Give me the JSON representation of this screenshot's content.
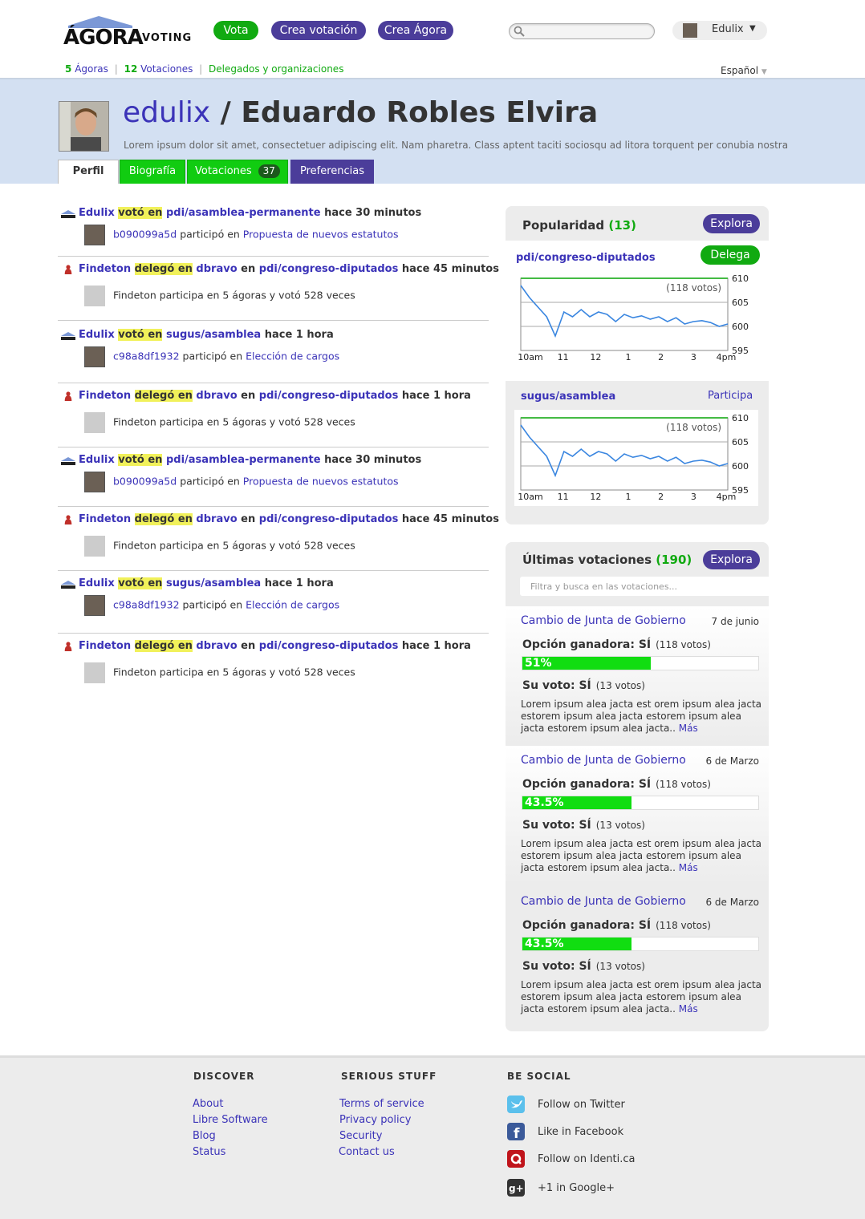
{
  "header": {
    "logo_text": "ÁGORA",
    "logo_sub": "VOTING",
    "buttons": {
      "vota": "Vota",
      "crea_votacion": "Crea votación",
      "crea_agora": "Crea Ágora"
    },
    "search_placeholder": "",
    "user": "Edulix"
  },
  "subnav": {
    "agoras_count": "5",
    "agoras_label": "Ágoras",
    "votaciones_count": "12",
    "votaciones_label": "Votaciones",
    "delegados": "Delegados y organizaciones",
    "sep": "|",
    "language": "Español"
  },
  "profile": {
    "username": "edulix",
    "slash": " / ",
    "fullname": "Eduardo Robles Elvira",
    "description": "Lorem ipsum dolor sit amet, consectetuer adipiscing elit. Nam pharetra. Class aptent taciti sociosqu ad litora torquent per conubia nostra",
    "tabs": {
      "perfil": "Perfil",
      "biografia": "Biografía",
      "votaciones": "Votaciones",
      "votaciones_count": "37",
      "preferencias": "Preferencias"
    }
  },
  "feed": [
    {
      "type": "vote",
      "actor": "Edulix",
      "verb": "votó en",
      "target": "pdi/asamblea-permanente",
      "time": "hace 30 minutos",
      "sub_id": "b090099a5d",
      "sub_text": "participó en",
      "sub_link": "Propuesta de nuevos estatutos"
    },
    {
      "type": "delegate",
      "actor": "Findeton",
      "verb": "delegó en",
      "delegate": "dbravo",
      "en": "en",
      "target": "pdi/congreso-diputados",
      "time": "hace 45 minutos",
      "sub_text": "Findeton participa en 5 ágoras y votó 528 veces"
    },
    {
      "type": "vote",
      "actor": "Edulix",
      "verb": "votó en",
      "target": "sugus/asamblea",
      "time": "hace 1 hora",
      "sub_id": "c98a8df1932",
      "sub_text": "participó en",
      "sub_link": "Elección de cargos"
    },
    {
      "type": "delegate",
      "actor": "Findeton",
      "verb": "delegó en",
      "delegate": "dbravo",
      "en": "en",
      "target": "pdi/congreso-diputados",
      "time": "hace 1 hora",
      "sub_text": "Findeton participa en 5 ágoras y votó 528 veces"
    },
    {
      "type": "vote",
      "actor": "Edulix",
      "verb": "votó en",
      "target": "pdi/asamblea-permanente",
      "time": "hace 30 minutos",
      "sub_id": "b090099a5d",
      "sub_text": "participó en",
      "sub_link": "Propuesta de nuevos estatutos"
    },
    {
      "type": "delegate",
      "actor": "Findeton",
      "verb": "delegó en",
      "delegate": "dbravo",
      "en": "en",
      "target": "pdi/congreso-diputados",
      "time": "hace 45 minutos",
      "sub_text": "Findeton participa en 5 ágoras y votó 528 veces"
    },
    {
      "type": "vote",
      "actor": "Edulix",
      "verb": "votó en",
      "target": "sugus/asamblea",
      "time": "hace 1 hora",
      "sub_id": "c98a8df1932",
      "sub_text": "participó en",
      "sub_link": "Elección de cargos"
    },
    {
      "type": "delegate",
      "actor": "Findeton",
      "verb": "delegó en",
      "delegate": "dbravo",
      "en": "en",
      "target": "pdi/congreso-diputados",
      "time": "hace 1 hora",
      "sub_text": "Findeton participa en 5 ágoras y votó 528 veces"
    }
  ],
  "popularity": {
    "title": "Popularidad",
    "count": "(13)",
    "explore": "Explora",
    "items": [
      {
        "name": "pdi/congreso-diputados",
        "action": "Delega",
        "votes_label": "(118 votos)"
      },
      {
        "name": "sugus/asamblea",
        "action": "Participa",
        "votes_label": "(118 votos)"
      }
    ]
  },
  "chart_data": [
    {
      "type": "line",
      "title": "pdi/congreso-diputados",
      "annotation": "(118 votos)",
      "categories": [
        "10am",
        "11",
        "12",
        "1",
        "2",
        "3",
        "4pm"
      ],
      "ylim": [
        595,
        610
      ],
      "yticks": [
        595,
        600,
        605,
        610
      ],
      "series": [
        {
          "values": [
            608.5,
            606,
            604,
            602,
            598,
            603,
            602,
            603.5,
            602,
            603,
            602.5,
            601,
            602.5,
            601.8,
            602.2,
            601.5,
            602,
            601,
            601.8,
            600.5,
            601,
            601.2,
            600.8,
            600,
            600.5
          ]
        }
      ]
    },
    {
      "type": "line",
      "title": "sugus/asamblea",
      "annotation": "(118 votos)",
      "categories": [
        "10am",
        "11",
        "12",
        "1",
        "2",
        "3",
        "4pm"
      ],
      "ylim": [
        595,
        610
      ],
      "yticks": [
        595,
        600,
        605,
        610
      ],
      "series": [
        {
          "values": [
            608.5,
            606,
            604,
            602,
            598,
            603,
            602,
            603.5,
            602,
            603,
            602.5,
            601,
            602.5,
            601.8,
            602.2,
            601.5,
            602,
            601,
            601.8,
            600.5,
            601,
            601.2,
            600.8,
            600,
            600.5
          ]
        }
      ]
    }
  ],
  "latest": {
    "title": "Últimas votaciones",
    "count": "(190)",
    "explore": "Explora",
    "filter_placeholder": "Filtra y busca en las votaciones...",
    "items": [
      {
        "title": "Cambio de Junta de Gobierno",
        "date": "7 de junio",
        "winner_label": "Opción ganadora: SÍ",
        "winner_votes": "(118 votos)",
        "percent_label": "51%",
        "percent": 0.51,
        "myvote_label": "Su voto: SÍ",
        "myvote_votes": "(13 votos)",
        "text": "Lorem ipsum alea jacta est orem ipsum alea jacta estorem ipsum alea jacta estorem ipsum alea jacta estorem ipsum alea jacta..",
        "more": "Más"
      },
      {
        "title": "Cambio de Junta de Gobierno",
        "date": "6 de Marzo",
        "winner_label": "Opción ganadora: SÍ",
        "winner_votes": "(118 votos)",
        "percent_label": "43.5%",
        "percent": 0.435,
        "myvote_label": "Su voto: SÍ",
        "myvote_votes": "(13 votos)",
        "text": "Lorem ipsum alea jacta est orem ipsum alea jacta estorem ipsum alea jacta estorem ipsum alea jacta estorem ipsum alea jacta..",
        "more": "Más"
      },
      {
        "title": "Cambio de Junta de Gobierno",
        "date": "6 de Marzo",
        "winner_label": "Opción ganadora: SÍ",
        "winner_votes": "(118 votos)",
        "percent_label": "43.5%",
        "percent": 0.435,
        "myvote_label": "Su voto: SÍ",
        "myvote_votes": "(13 votos)",
        "text": "Lorem ipsum alea jacta est orem ipsum alea jacta estorem ipsum alea jacta estorem ipsum alea jacta estorem ipsum alea jacta..",
        "more": "Más"
      }
    ]
  },
  "footer": {
    "discover": {
      "title": "DISCOVER",
      "links": [
        "About",
        "Libre Software",
        "Blog",
        "Status"
      ]
    },
    "serious": {
      "title": "SERIOUS STUFF",
      "links": [
        "Terms of service",
        "Privacy policy",
        "Security",
        "Contact us"
      ]
    },
    "social": {
      "title": "BE SOCIAL",
      "links": [
        "Follow on Twitter",
        "Like in Facebook",
        "Follow on Identi.ca",
        "+1 in Google+"
      ]
    }
  },
  "colors": {
    "green": "#11aa11",
    "purple": "#4b3d9a",
    "link": "#3b33b8",
    "band": "#d3e0f2",
    "highlight": "#f1f15a"
  }
}
